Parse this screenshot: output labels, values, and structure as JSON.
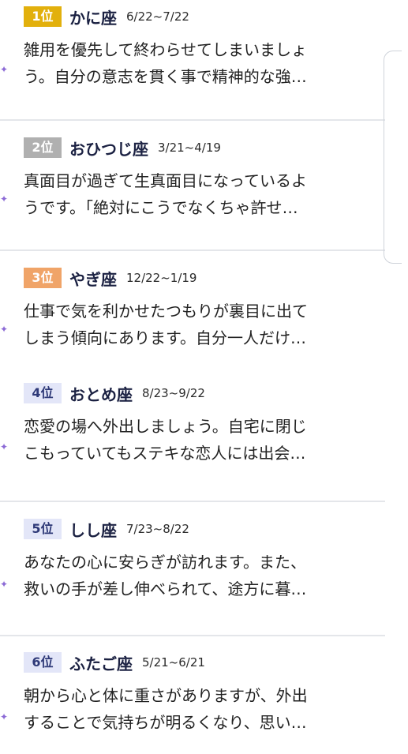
{
  "colors": {
    "gold": "#e2b00c",
    "silver": "#b0b0b0",
    "bronze": "#f0a468",
    "plain_bg": "#e3e6f8",
    "plain_text": "#2f3a78",
    "star": "#8c6ad6"
  },
  "rankings": [
    {
      "rank": "1位",
      "sign": "かに座",
      "dates": "6/22~7/22",
      "line1": "雑用を優先して終わらせてしまいましょ",
      "line2": "う。自分の意志を貫く事で精神的な強…",
      "badge_style": "gold"
    },
    {
      "rank": "2位",
      "sign": "おひつじ座",
      "dates": "3/21~4/19",
      "line1": "真面目が過ぎて生真面目になっているよ",
      "line2": "うです。「絶対にこうでなくちゃ許せ…",
      "badge_style": "silver"
    },
    {
      "rank": "3位",
      "sign": "やぎ座",
      "dates": "12/22~1/19",
      "line1": "仕事で気を利かせたつもりが裏目に出て",
      "line2": "しまう傾向にあります。自分一人だけ…",
      "badge_style": "bronze"
    },
    {
      "rank": "4位",
      "sign": "おとめ座",
      "dates": "8/23~9/22",
      "line1": "恋愛の場へ外出しましょう。自宅に閉じ",
      "line2": "こもっていてもステキな恋人には出会…",
      "badge_style": "plain"
    },
    {
      "rank": "5位",
      "sign": "しし座",
      "dates": "7/23~8/22",
      "line1": "あなたの心に安らぎが訪れます。また、",
      "line2": "救いの手が差し伸べられて、途方に暮…",
      "badge_style": "plain"
    },
    {
      "rank": "6位",
      "sign": "ふたご座",
      "dates": "5/21~6/21",
      "line1": "朝から心と体に重さがありますが、外出",
      "line2": "することで気持ちが明るくなり、思い…",
      "badge_style": "plain"
    }
  ]
}
